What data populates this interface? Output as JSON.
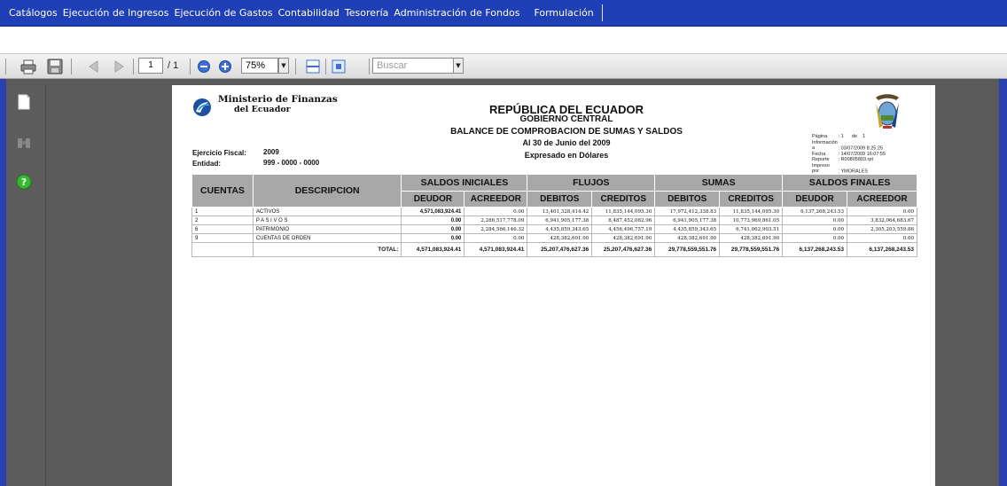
{
  "menu": {
    "items": [
      "Catálogos",
      "Ejecución de Ingresos",
      "Ejecución de Gastos",
      "Contabilidad",
      "Tesorería",
      "Administración de Fondos",
      "Formulación"
    ]
  },
  "toolbar": {
    "page_current": "1",
    "page_total": "/ 1",
    "zoom": "75%",
    "search_placeholder": "Buscar"
  },
  "report": {
    "ministry_line1": "Ministerio de Finanzas",
    "ministry_line2": "del Ecuador",
    "title": "REPÚBLICA DEL ECUADOR",
    "subtitle": "GOBIERNO CENTRAL",
    "report_name": "BALANCE DE COMPROBACION DE SUMAS Y SALDOS",
    "date_line": "Al 30 de Junio del 2009",
    "currency_line": "Expresado en Dólares",
    "fiscal_label": "Ejercicio Fiscal:",
    "fiscal_value": "2009",
    "entity_label": "Entidad:",
    "entity_value": "999 - 0000 - 0000",
    "info": {
      "pagina_label": "Página",
      "pagina_value": ": 1",
      "pagina_de": "de",
      "pagina_total": "1",
      "informacion_label": "Información a",
      "informacion_value": ": 03/07/2009  8:25:25",
      "fecha_label": "Fecha",
      "fecha_value": ": 14/07/2009 16:07:55",
      "reporte_label": "Reporte",
      "reporte_value": ": R00805803.rpt",
      "impreso_label": "Impreso por",
      "impreso_value": ": YMORALES"
    },
    "columns": {
      "cuentas": "CUENTAS",
      "descripcion": "DESCRIPCION",
      "saldos_iniciales": "SALDOS INICIALES",
      "flujos": "FLUJOS",
      "sumas": "SUMAS",
      "saldos_finales": "SALDOS FINALES",
      "deudor": "DEUDOR",
      "acreedor": "ACREEDOR",
      "debitos": "DEBITOS",
      "creditos": "CREDITOS"
    },
    "rows": [
      {
        "cuenta": "1",
        "desc": "ACTIVOS",
        "si_deudor": "4,571,083,924.41",
        "si_acreedor": "0.00",
        "fl_debitos": "13,401,328,414.42",
        "fl_creditos": "11,835,144,095.30",
        "su_debitos": "17,972,412,338.83",
        "su_creditos": "11,835,144,095.30",
        "sf_deudor": "6,137,268,243.53",
        "sf_acreedor": "0.00"
      },
      {
        "cuenta": "2",
        "desc": "P A S I V O S",
        "si_deudor": "0.00",
        "si_acreedor": "2,286,517,778.09",
        "fl_debitos": "6,941,905,177.38",
        "fl_creditos": "8,487,452,082.96",
        "su_debitos": "6,941,905,177.38",
        "su_creditos": "10,773,969,861.05",
        "sf_deudor": "0.00",
        "sf_acreedor": "3,832,064,683.67"
      },
      {
        "cuenta": "6",
        "desc": "PATRIMONIO",
        "si_deudor": "0.00",
        "si_acreedor": "2,284,566,146.32",
        "fl_debitos": "4,435,859,343.65",
        "fl_creditos": "4,456,496,757.19",
        "su_debitos": "4,435,859,343.65",
        "su_creditos": "6,741,062,903.51",
        "sf_deudor": "0.00",
        "sf_acreedor": "2,305,203,559.86"
      },
      {
        "cuenta": "9",
        "desc": "CUENTAS DE ORDEN",
        "si_deudor": "0.00",
        "si_acreedor": "0.00",
        "fl_debitos": "428,382,691.90",
        "fl_creditos": "428,382,691.90",
        "su_debitos": "428,382,691.90",
        "su_creditos": "428,382,691.90",
        "sf_deudor": "0.00",
        "sf_acreedor": "0.00"
      }
    ],
    "total": {
      "label": "TOTAL:",
      "si_deudor": "4,571,083,924.41",
      "si_acreedor": "4,571,083,924.41",
      "fl_debitos": "25,207,476,627.36",
      "fl_creditos": "25,207,476,627.36",
      "su_debitos": "29,778,559,551.76",
      "su_creditos": "29,778,559,551.76",
      "sf_deudor": "6,137,268,243.53",
      "sf_acreedor": "6,137,268,243.53"
    }
  },
  "colors": {
    "menubar": "#1e3fb5",
    "table_header": "#a8a8a8",
    "viewer_bg": "#5a5a5a"
  },
  "icons": [
    "print-icon",
    "save-icon",
    "prev-page-icon",
    "next-page-icon",
    "zoom-out-icon",
    "zoom-in-icon",
    "fit-width-icon",
    "fit-page-icon",
    "document-icon",
    "binoculars-icon",
    "help-icon"
  ]
}
